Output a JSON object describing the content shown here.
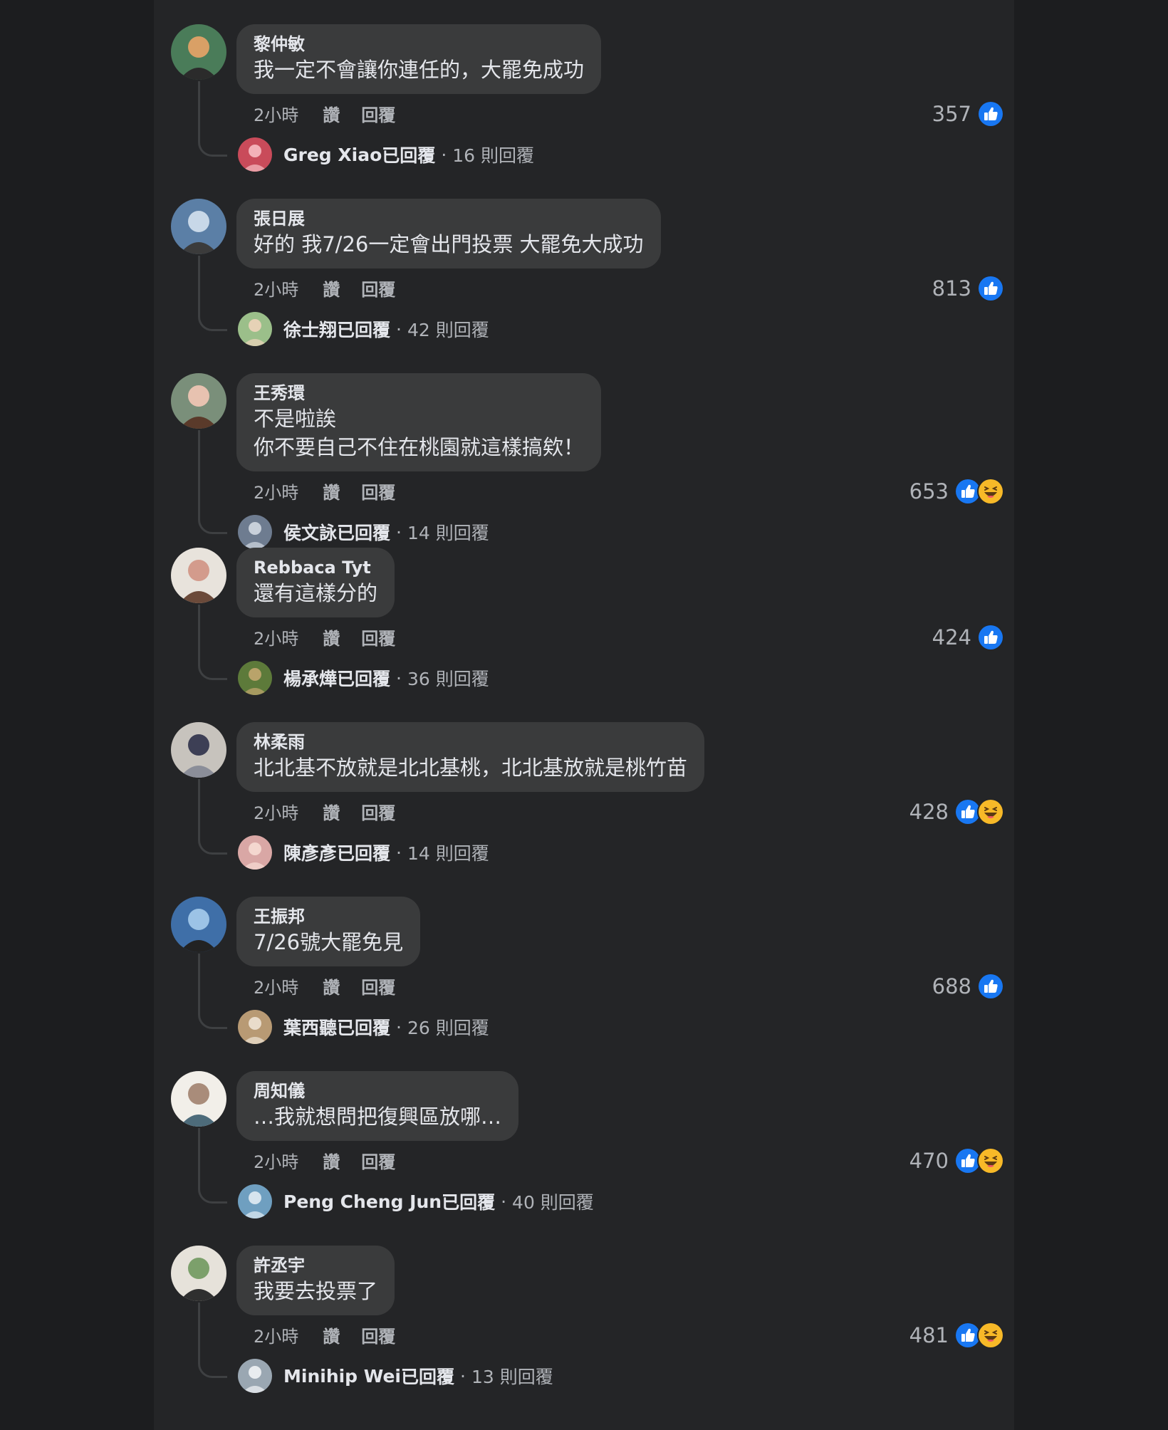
{
  "actions": {
    "time": "2小時",
    "like": "讚",
    "reply": "回覆"
  },
  "replied_verb": "已回覆",
  "separator": "·",
  "comments": [
    {
      "author": "黎仲敏",
      "lines": [
        "我一定不會讓你連任的，大罷免成功"
      ],
      "count": "357",
      "reactions": [
        "like-reaction-icon"
      ],
      "replier": "Greg Xiao",
      "reply_count": "16 則回覆"
    },
    {
      "author": "張日展",
      "lines": [
        "好的 我7/26一定會出門投票 大罷免大成功"
      ],
      "count": "813",
      "reactions": [
        "like-reaction-icon"
      ],
      "replier": "徐士翔",
      "reply_count": "42 則回覆"
    },
    {
      "author": "王秀環",
      "lines": [
        "不是啦誒",
        "你不要自己不住在桃園就這樣搞欸！"
      ],
      "count": "653",
      "reactions": [
        "like-reaction-icon",
        "haha-reaction-icon"
      ],
      "replier": "侯文詠",
      "reply_count": "14 則回覆"
    },
    {
      "author": "Rebbaca Tyt",
      "lines": [
        "還有這樣分的"
      ],
      "count": "424",
      "reactions": [
        "like-reaction-icon"
      ],
      "replier": "楊承燁",
      "reply_count": "36 則回覆"
    },
    {
      "author": "林柔雨",
      "lines": [
        "北北基不放就是北北基桃，北北基放就是桃竹苗"
      ],
      "count": "428",
      "reactions": [
        "like-reaction-icon",
        "haha-reaction-icon"
      ],
      "replier": "陳彥彥",
      "reply_count": "14 則回覆"
    },
    {
      "author": "王振邦",
      "lines": [
        "7/26號大罷免見"
      ],
      "count": "688",
      "reactions": [
        "like-reaction-icon"
      ],
      "replier": "葉西聽",
      "reply_count": "26 則回覆"
    },
    {
      "author": "周知儀",
      "lines": [
        "…我就想問把復興區放哪…"
      ],
      "count": "470",
      "reactions": [
        "like-reaction-icon",
        "haha-reaction-icon"
      ],
      "replier": "Peng Cheng Jun",
      "reply_count": "40 則回覆"
    },
    {
      "author": "許丞宇",
      "lines": [
        "我要去投票了"
      ],
      "count": "481",
      "reactions": [
        "like-reaction-icon",
        "haha-reaction-icon"
      ],
      "replier": "Minihip Wei",
      "reply_count": "13 則回覆"
    }
  ],
  "colors": {
    "page_background": "#1c1d1f",
    "panel_background": "#242527",
    "bubble_background": "#3a3b3c",
    "primary_text": "#e4e6eb",
    "secondary_text": "#b0b3b8",
    "like_blue": "#1877f2",
    "haha_yellow": "#f7b928"
  }
}
